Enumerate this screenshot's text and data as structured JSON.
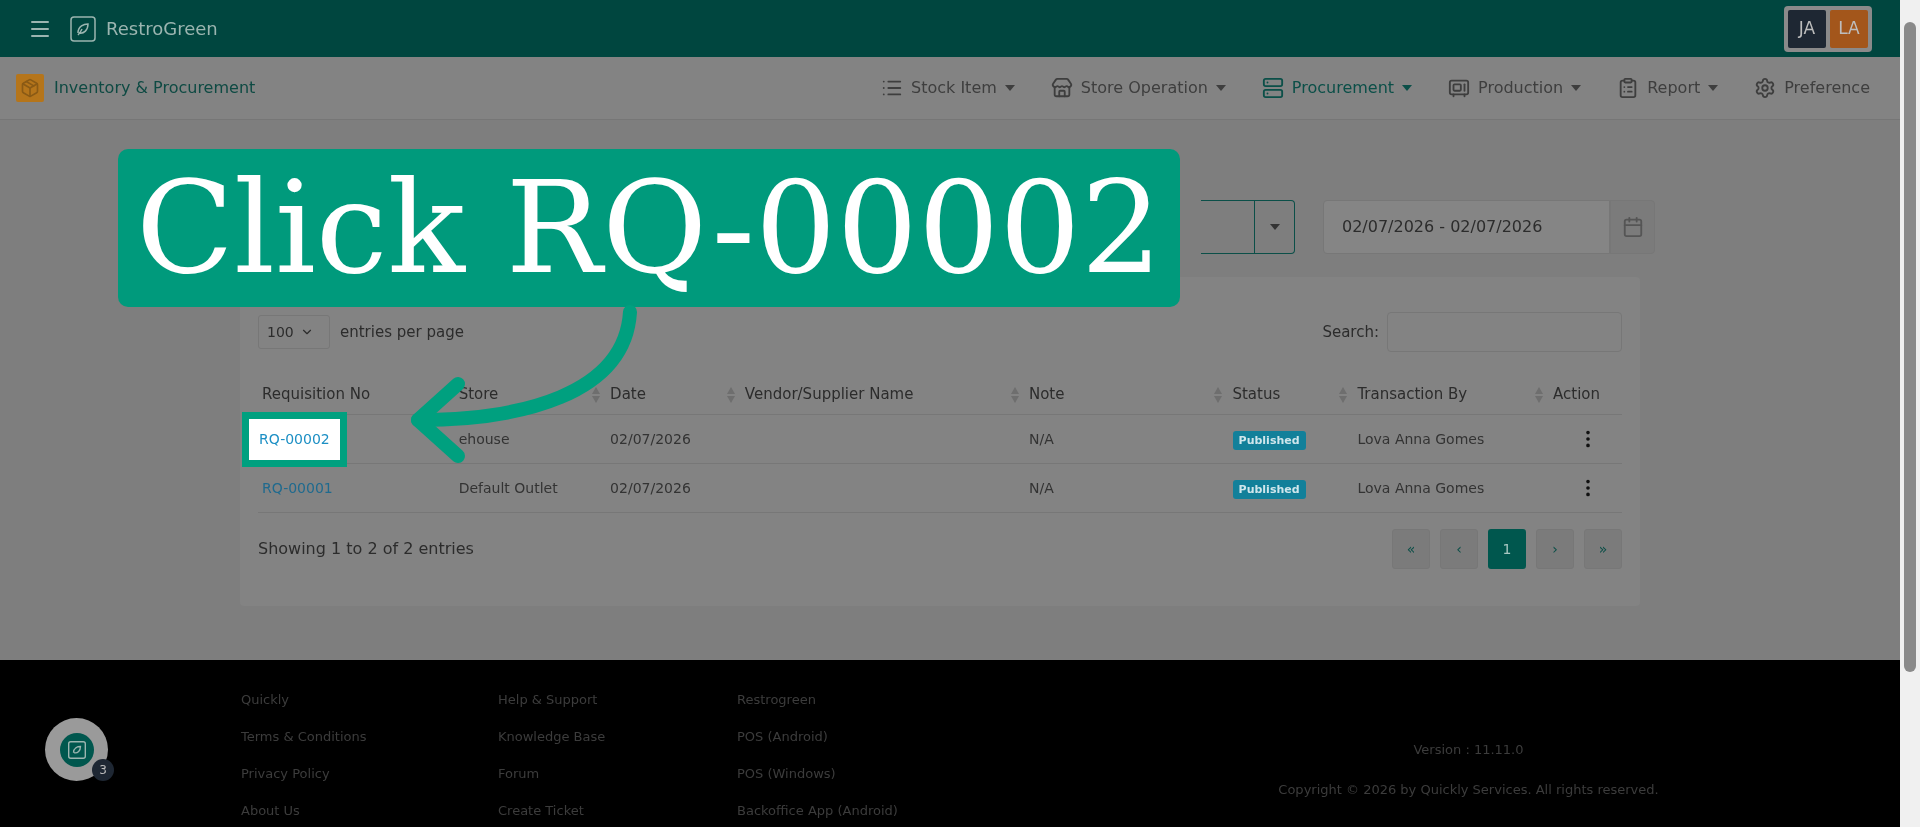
{
  "header": {
    "brand": "RestroGreen",
    "avatars": [
      {
        "initials": "JA",
        "color": "#1e2733"
      },
      {
        "initials": "LA",
        "color": "#a3561b"
      }
    ]
  },
  "module": {
    "title": "Inventory & Procurement"
  },
  "nav": [
    {
      "label": "Stock Item",
      "kind": "list",
      "selected": false,
      "dropdown": true
    },
    {
      "label": "Store Operation",
      "kind": "store",
      "selected": false,
      "dropdown": true
    },
    {
      "label": "Procurement",
      "kind": "procurement",
      "selected": true,
      "dropdown": true
    },
    {
      "label": "Production",
      "kind": "production",
      "selected": false,
      "dropdown": true
    },
    {
      "label": "Report",
      "kind": "report",
      "selected": false,
      "dropdown": true
    },
    {
      "label": "Preference",
      "kind": "settings",
      "selected": false,
      "dropdown": false
    }
  ],
  "filters": {
    "date_range": "02/07/2026 - 02/07/2026"
  },
  "callout": {
    "text": "Click RQ-00002"
  },
  "table": {
    "page_size": "100",
    "page_size_label": "entries per page",
    "search_label": "Search:",
    "columns": [
      "Requisition No",
      "Store",
      "Date",
      "Vendor/Supplier Name",
      "Note",
      "Status",
      "Transaction By",
      "Action"
    ],
    "rows": [
      {
        "requisition_no": "RQ-00002",
        "highlighted": true,
        "store": "ehouse",
        "date": "02/07/2026",
        "note": "N/A",
        "status": "Published",
        "transaction_by": "Lova Anna Gomes"
      },
      {
        "requisition_no": "RQ-00001",
        "highlighted": false,
        "store": "Default Outlet",
        "date": "02/07/2026",
        "note": "N/A",
        "status": "Published",
        "transaction_by": "Lova Anna Gomes"
      }
    ],
    "summary": "Showing 1 to 2 of 2 entries",
    "pagination": [
      {
        "label": "«",
        "selected": false
      },
      {
        "label": "‹",
        "selected": false
      },
      {
        "label": "1",
        "selected": true
      },
      {
        "label": "›",
        "selected": false
      },
      {
        "label": "»",
        "selected": false
      }
    ]
  },
  "footer": {
    "columns": [
      [
        "Quickly",
        "Terms & Conditions",
        "Privacy Policy",
        "About Us"
      ],
      [
        "Help & Support",
        "Knowledge Base",
        "Forum",
        "Create Ticket"
      ],
      [
        "Restrogreen",
        "POS (Android)",
        "POS (Windows)",
        "Backoffice App (Android)"
      ]
    ],
    "version": "Version : 11.11.0",
    "copyright": "Copyright © 2026 by Quickly Services. All rights reserved."
  },
  "chat": {
    "badge": "3"
  }
}
